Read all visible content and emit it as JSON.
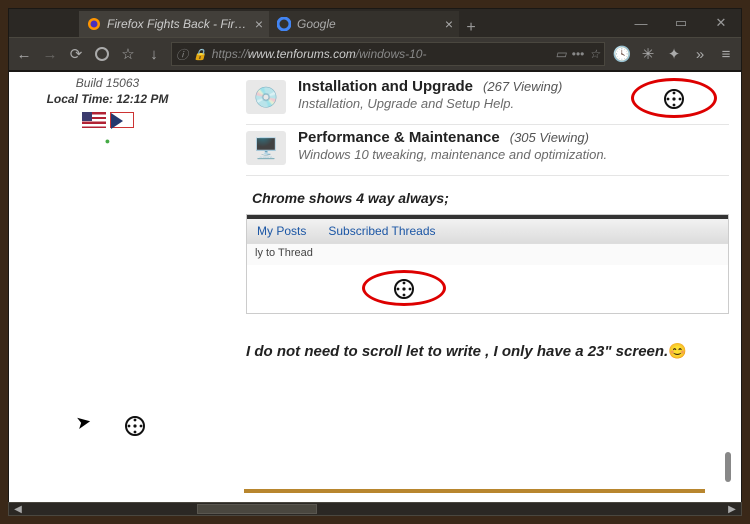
{
  "tabs": [
    {
      "title": "Firefox Fights Back - Firefo",
      "active": true
    },
    {
      "title": "Google",
      "active": false
    }
  ],
  "window": {
    "min": "—",
    "max": "▭",
    "close": "✕"
  },
  "url": {
    "proto": "https://",
    "host": "www.tenforums.com",
    "path": "/windows-10-"
  },
  "sidebar": {
    "build": "Build 15063",
    "localtime": "Local Time: 12:12 PM"
  },
  "forums": [
    {
      "title": "Installation and Upgrade",
      "viewing": "(267 Viewing)",
      "desc": "Installation, Upgrade and Setup Help."
    },
    {
      "title": "Performance & Maintenance",
      "viewing": "(305 Viewing)",
      "desc": "Windows 10 tweaking, maintenance and optimization."
    }
  ],
  "note_chrome": "Chrome shows 4 way always;",
  "embed": {
    "tab1": "My Posts",
    "tab2": "Subscribed Threads",
    "reply": "ly to Thread"
  },
  "bottom_text": "I do not need to scroll let to write , I only have a 23\" screen."
}
